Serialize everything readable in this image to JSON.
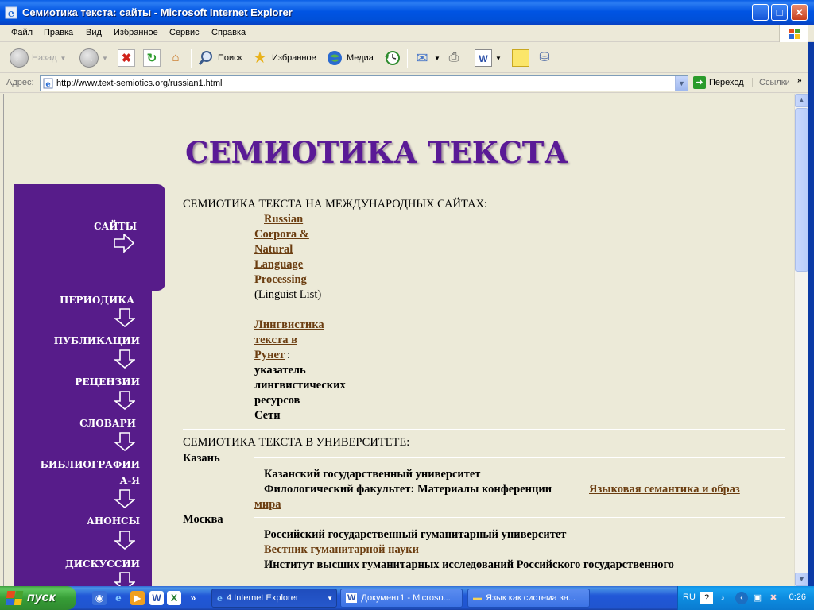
{
  "window": {
    "title": "Семиотика текста: сайты - Microsoft Internet Explorer",
    "minimize": "_",
    "maximize": "□",
    "close": "✕"
  },
  "menu": [
    "Файл",
    "Правка",
    "Вид",
    "Избранное",
    "Сервис",
    "Справка"
  ],
  "toolbar": {
    "back_label": "Назад",
    "search_label": "Поиск",
    "favorites_label": "Избранное",
    "media_label": "Медиа"
  },
  "address": {
    "label": "Адрес:",
    "url": "http://www.text-semiotics.org/russian1.html",
    "go_label": "Переход",
    "links_label": "Ссылки"
  },
  "page": {
    "site_title": "СЕМИОТИКА ТЕКСТА",
    "nav": {
      "active": "САЙТЫ",
      "items": [
        "ПЕРИОДИКА",
        "ПУБЛИКАЦИИ",
        "РЕЦЕНЗИИ",
        "СЛОВАРИ",
        "БИБЛИОГРАФИИ",
        "А-Я",
        "АНОНСЫ",
        "ДИСКУССИИ"
      ]
    },
    "section1": {
      "heading": "СЕМИОТИКА ТЕКСТА НА МЕЖДУНАРОДНЫХ САЙТАХ:",
      "link1_lines": [
        "Russian",
        "Corpora &",
        "Natural",
        "Language",
        "Processing"
      ],
      "link1_note": "(Linguist List)",
      "link2_lines": [
        "Лингвистика",
        "текста в",
        "Рунет"
      ],
      "link2_suffix": " :",
      "desc_lines": [
        "указатель",
        "лингвистических",
        "ресурсов",
        "Сети"
      ]
    },
    "section2": {
      "heading": "СЕМИОТИКА ТЕКСТА В УНИВЕРСИТЕТЕ:",
      "kazan": {
        "city": "Казань",
        "univ": "Казанский государственный университет",
        "faculty_prefix": "Филологический факультет: Материалы конференции ",
        "link_line1": "Языковая семантика и образ",
        "link_line2": "мира"
      },
      "moscow": {
        "city": "Москва",
        "univ": "Российский государственный гуманитарный университет",
        "journal": "Вестник гуманитарной науки",
        "institute": "Институт высших гуманитарных исследований Российского государственного"
      }
    }
  },
  "taskbar": {
    "start_label": "пуск",
    "tasks": [
      "4 Internet Explorer",
      "Документ1 - Microso...",
      "Язык как система зн..."
    ],
    "lang": "RU",
    "clock": "0:26"
  },
  "colors": {
    "nav_purple": "#571c8a",
    "title_purple": "#5a1a96",
    "link_brown": "#6b3d10",
    "page_bg": "#ecead8"
  }
}
